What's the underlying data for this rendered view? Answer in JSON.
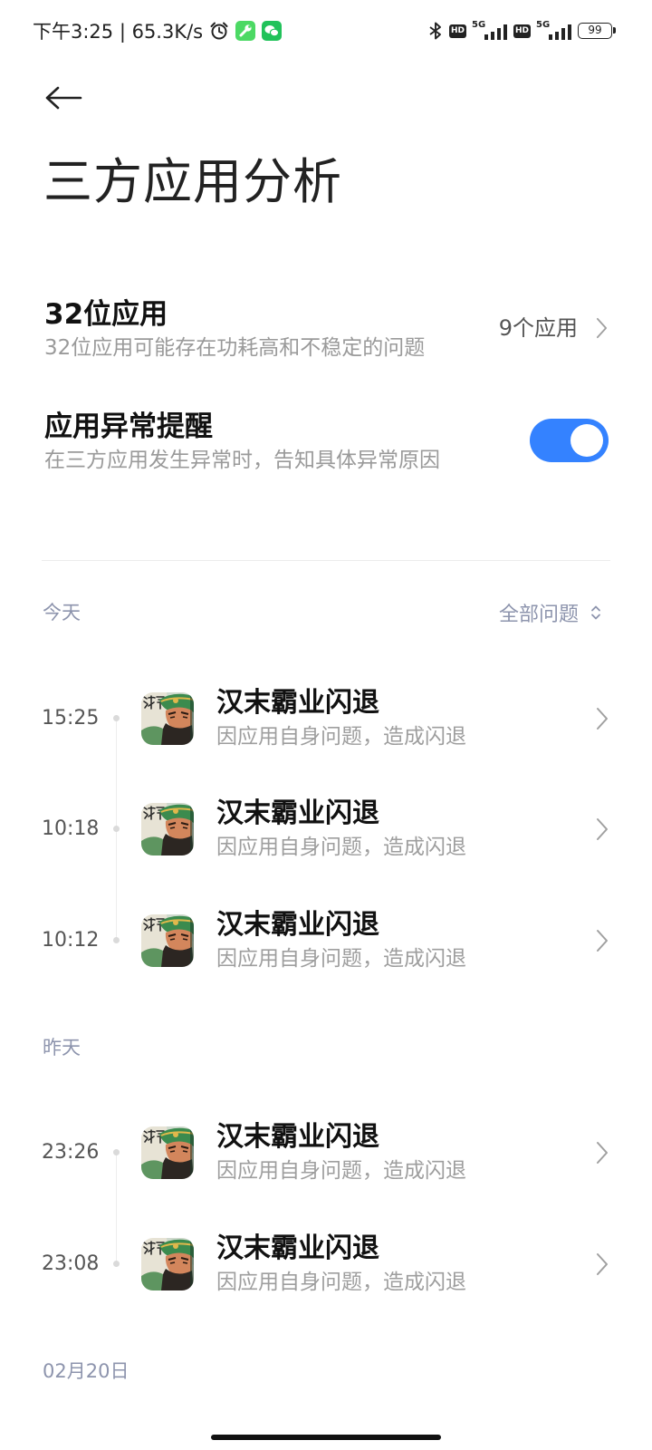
{
  "status_bar": {
    "time_and_speed": "下午3:25 | 65.3K/s",
    "sim1_hd": "HD",
    "sim1_network": "5G",
    "sim2_hd": "HD",
    "sim2_network": "5G",
    "battery": "99",
    "icons": [
      "alarm-icon",
      "toolbox-app-icon",
      "wechat-icon",
      "bluetooth-icon",
      "signal-icon",
      "battery-icon"
    ]
  },
  "header": {
    "back_icon": "arrow-left-icon",
    "title": "三方应用分析"
  },
  "settings": {
    "apps_32bit": {
      "title": "32位应用",
      "subtitle": "32位应用可能存在功耗高和不稳定的问题",
      "value": "9个应用"
    },
    "anomaly_alert": {
      "title": "应用异常提醒",
      "subtitle": "在三方应用发生异常时，告知具体异常原因",
      "enabled": true
    }
  },
  "filter": {
    "label": "全部问题",
    "icon": "sort-updown-icon"
  },
  "groups": [
    {
      "label": "今天",
      "items": [
        {
          "time": "15:25",
          "title": "汉末霸业闪退",
          "subtitle": "因应用自身问题，造成闪退"
        },
        {
          "time": "10:18",
          "title": "汉末霸业闪退",
          "subtitle": "因应用自身问题，造成闪退"
        },
        {
          "time": "10:12",
          "title": "汉末霸业闪退",
          "subtitle": "因应用自身问题，造成闪退"
        }
      ]
    },
    {
      "label": "昨天",
      "items": [
        {
          "time": "23:26",
          "title": "汉末霸业闪退",
          "subtitle": "因应用自身问题，造成闪退"
        },
        {
          "time": "23:08",
          "title": "汉末霸业闪退",
          "subtitle": "因应用自身问题，造成闪退"
        }
      ]
    },
    {
      "label": "02月20日",
      "items": []
    }
  ],
  "colors": {
    "accent": "#3482FF",
    "text_primary": "#111111",
    "text_secondary": "#9E9E9E",
    "group_label": "#8D94AD",
    "background": "#FFFFFF"
  }
}
